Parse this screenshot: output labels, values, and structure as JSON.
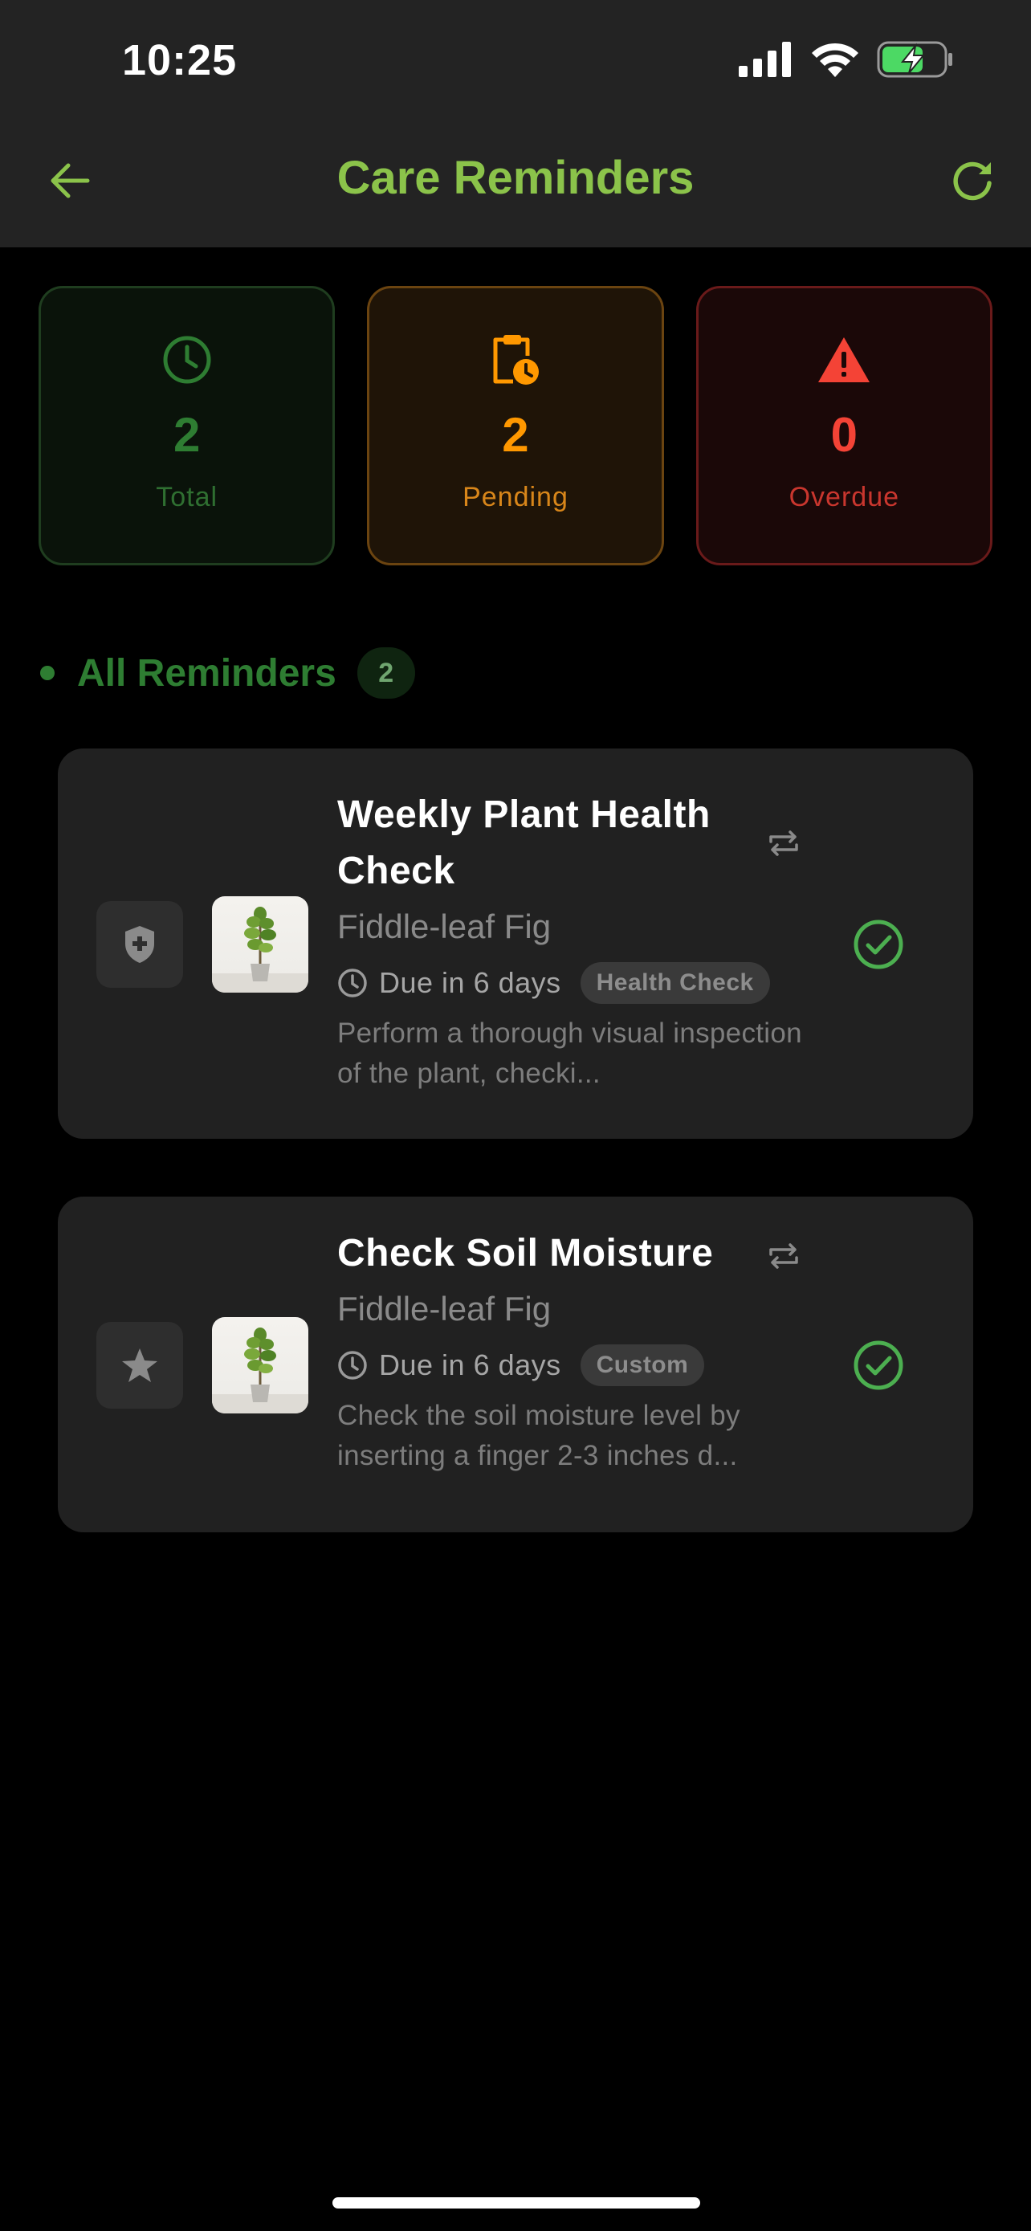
{
  "status_bar": {
    "time": "10:25"
  },
  "header": {
    "title": "Care Reminders"
  },
  "summary": {
    "total": {
      "value": "2",
      "label": "Total",
      "icon": "clock-icon"
    },
    "pending": {
      "value": "2",
      "label": "Pending",
      "icon": "clipboard-clock-icon"
    },
    "overdue": {
      "value": "0",
      "label": "Overdue",
      "icon": "warning-icon"
    }
  },
  "section": {
    "title": "All Reminders",
    "count": "2"
  },
  "reminders": [
    {
      "title": "Weekly Plant Health Check",
      "plant": "Fiddle-leaf Fig",
      "due": "Due in 6 days",
      "tag": "Health Check",
      "description": "Perform a thorough visual inspection of the plant, checki...",
      "type_icon": "shield-plus-icon"
    },
    {
      "title": "Check Soil Moisture",
      "plant": "Fiddle-leaf Fig",
      "due": "Due in 6 days",
      "tag": "Custom",
      "description": "Check the soil moisture level by inserting a finger 2-3 inches d...",
      "type_icon": "star-icon"
    }
  ],
  "colors": {
    "accent": "#8bc34a",
    "total": "#2e7d32",
    "pending": "#ff9800",
    "overdue": "#f44336",
    "complete": "#4caf50"
  }
}
